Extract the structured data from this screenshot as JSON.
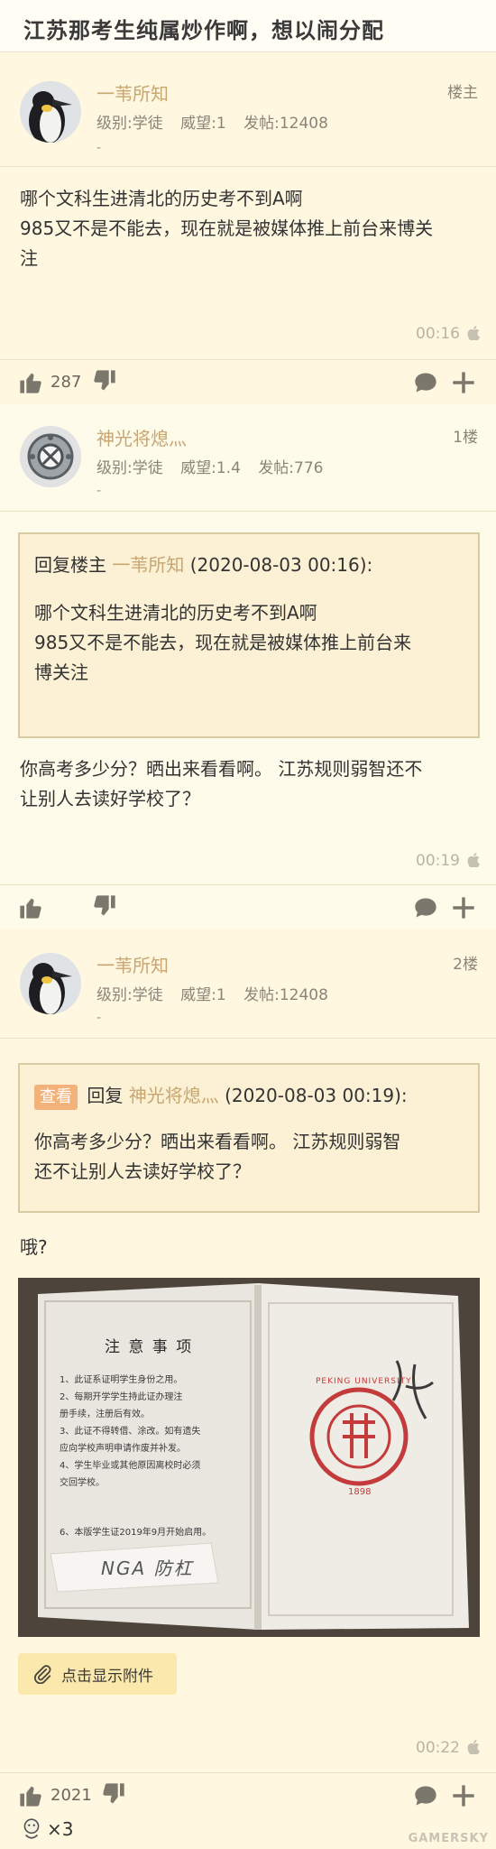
{
  "header": {
    "title": "江苏那考生纯属炒作啊，想以闹分配"
  },
  "posts": [
    {
      "author": "一苇所知",
      "level": "级别:学徒",
      "prestige": "威望:1",
      "post_count": "发帖:12408",
      "dash": "-",
      "floor": "楼主",
      "content_lines": [
        "哪个文科生进清北的历史考不到A啊",
        "985又不是不能去，现在就是被媒体推上前台来博关",
        "注"
      ],
      "time": "00:16",
      "likes": "287"
    },
    {
      "author": "神光将熄灬",
      "level": "级别:学徒",
      "prestige": "威望:1.4",
      "post_count": "发帖:776",
      "dash": "-",
      "floor": "1楼",
      "quote": {
        "prefix": "回复楼主 ",
        "user": "一苇所知",
        "time": " (2020-08-03 00:16):",
        "lines": [
          "哪个文科生进清北的历史考不到A啊",
          "985又不是不能去，现在就是被媒体推上前台来",
          "博关注"
        ]
      },
      "content_lines": [
        "你高考多少分？晒出来看看啊。 江苏规则弱智还不",
        "让别人去读好学校了？"
      ],
      "time": "00:19",
      "likes": ""
    },
    {
      "author": "一苇所知",
      "level": "级别:学徒",
      "prestige": "威望:1",
      "post_count": "发帖:12408",
      "dash": "-",
      "floor": "2楼",
      "quote": {
        "tag": "查看",
        "prefix": " 回复 ",
        "user": "神光将熄灬",
        "time": " (2020-08-03 00:19):",
        "lines": [
          "你高考多少分？晒出来看看啊。 江苏规则弱智",
          "还不让别人去读好学校了？"
        ]
      },
      "content_lines": [
        "哦?"
      ],
      "photo": {
        "left_title": "注 意 事 项",
        "left_lines": [
          "1、此证系证明学生身份之用。",
          "2、每期开学学生持此证办理注",
          "册手续，注册后有效。",
          "3、此证不得转借、涂改。如有遗失",
          "应向学校声明申请作废并补发。",
          "4、学生毕业或其他原因离校时必须",
          "交回学校。",
          "6、本版学生证2019年9月开始启用。"
        ],
        "note": "NGA  防杠",
        "seal_text": "PEKING UNIVERSITY",
        "seal_year": "1898"
      },
      "attach_label": "点击显示附件",
      "time": "00:22",
      "likes": "2021"
    }
  ],
  "footer": {
    "reaction_count": "×3"
  },
  "watermark": "GAMERSKY",
  "colors": {
    "background": "#fff9e3",
    "author": "#c7a672",
    "quote_border": "#d8cba4",
    "attach": "#fbe8ad"
  }
}
